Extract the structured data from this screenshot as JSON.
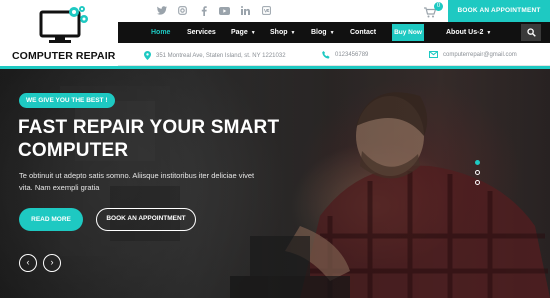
{
  "brand": {
    "name": "COMPUTER REPAIR",
    "accent": "#1ec9c2",
    "dark": "#111111"
  },
  "topbar": {
    "social": [
      "twitter-icon",
      "instagram-icon",
      "facebook-icon",
      "youtube-icon",
      "linkedin-icon",
      "vk-icon"
    ],
    "cart_count": "0",
    "book_label": "BOOK AN APPOINTMENT"
  },
  "nav": {
    "items": [
      {
        "label": "Home",
        "dropdown": false
      },
      {
        "label": "Services",
        "dropdown": false
      },
      {
        "label": "Page",
        "dropdown": true
      },
      {
        "label": "Shop",
        "dropdown": true
      },
      {
        "label": "Blog",
        "dropdown": true
      },
      {
        "label": "Contact",
        "dropdown": false
      }
    ],
    "buy_label": "Buy Now",
    "about_label": "About Us-2"
  },
  "contact": {
    "address": "351 Montreal Ave, Staten Island, st. NY 1221032",
    "phone": "0123456789",
    "email": "computerrepair@gmail.com"
  },
  "hero": {
    "tag": "WE GIVE YOU THE BEST !",
    "title": "FAST REPAIR YOUR SMART COMPUTER",
    "subtitle": "Te obtinuit ut adepto satis somno. Aliisque institoribus iter deliciae vivet vita. Nam exempli gratia",
    "read_more": "READ MORE",
    "book": "BOOK AN APPOINTMENT",
    "active_slide": 1,
    "slide_count": 3
  }
}
